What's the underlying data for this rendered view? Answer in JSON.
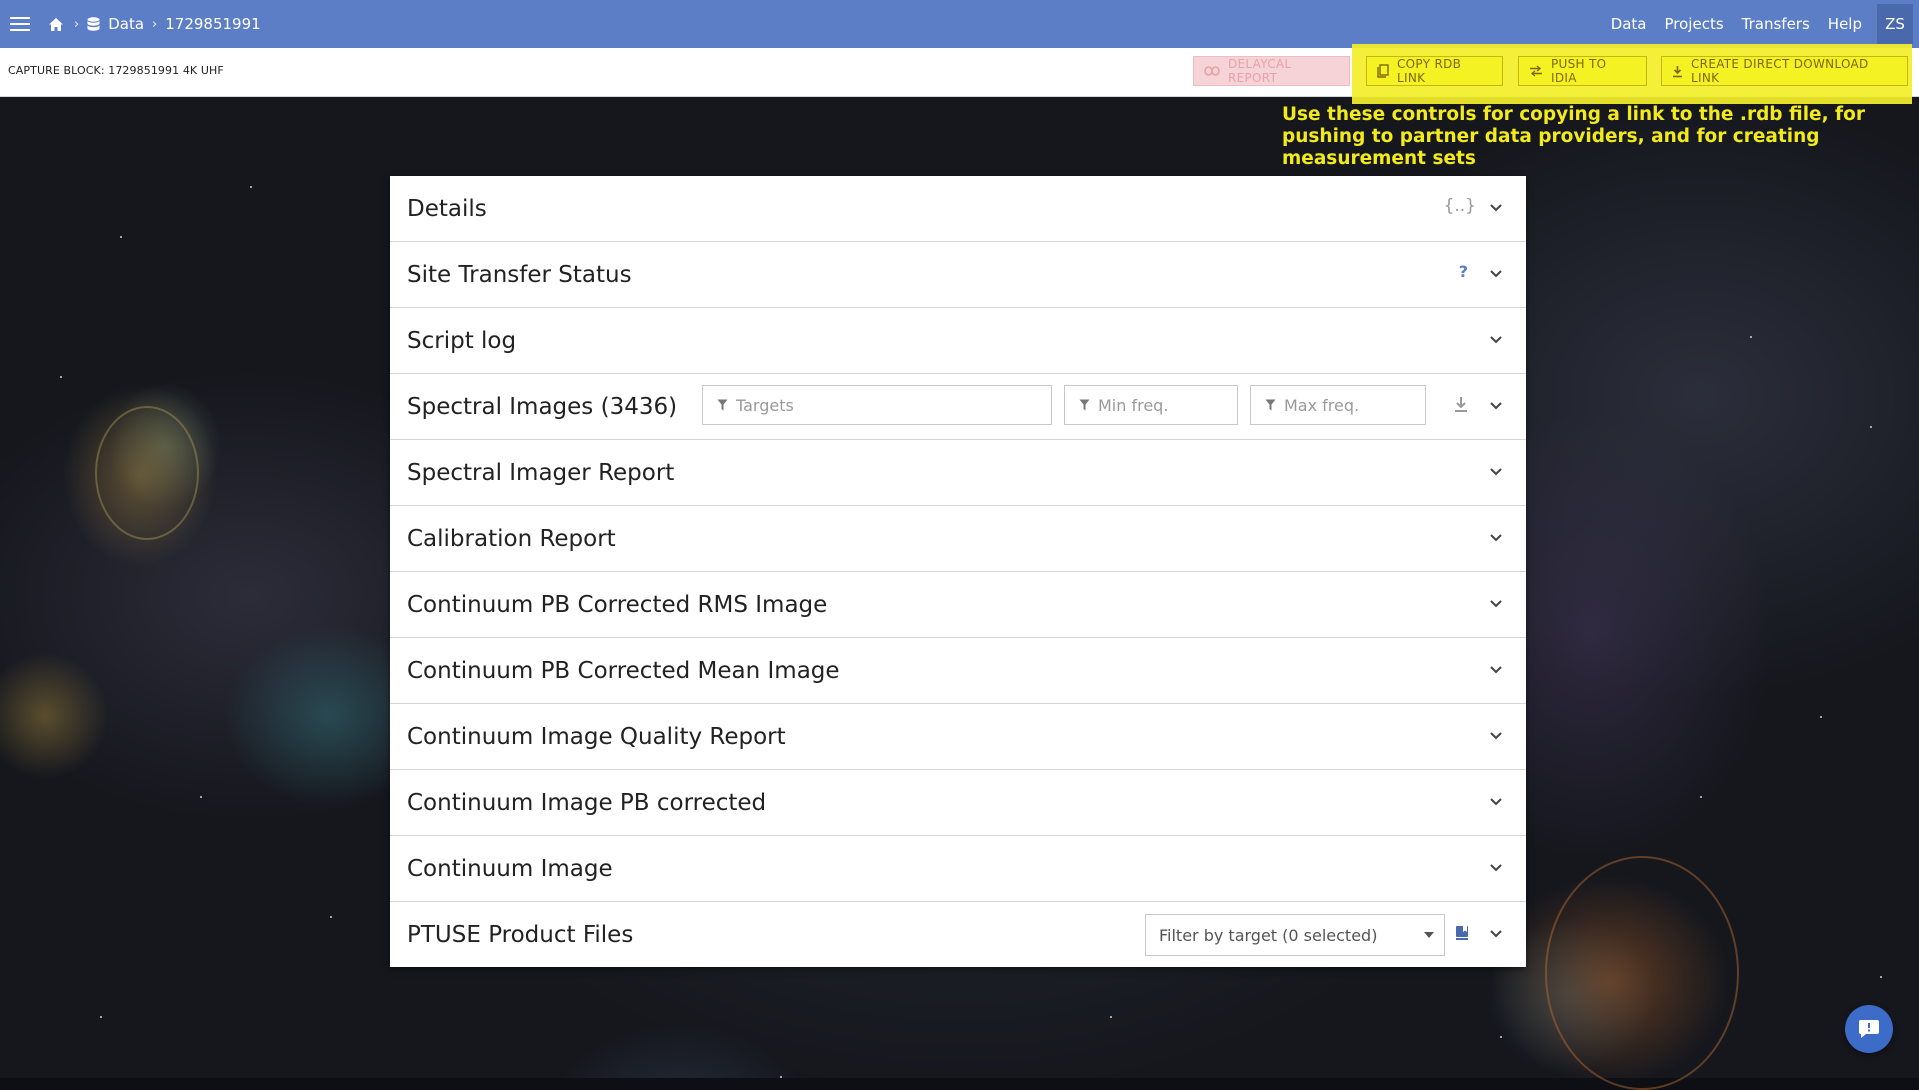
{
  "nav": {
    "breadcrumb_data": "Data",
    "breadcrumb_id": "1729851991",
    "links": [
      "Data",
      "Projects",
      "Transfers",
      "Help"
    ],
    "avatar_initials": "ZS"
  },
  "toolbar": {
    "capture_block_title": "CAPTURE BLOCK: 1729851991 4K UHF",
    "delaycal_label": "DELAYCAL REPORT",
    "copy_rdb_label": "COPY RDB LINK",
    "push_idia_label": "PUSH TO IDIA",
    "create_download_label": "CREATE DIRECT DOWNLOAD LINK"
  },
  "annotation": {
    "text": "Use these controls for copying a link to the .rdb file, for pushing to partner data providers, and for creating measurement sets"
  },
  "panels": [
    {
      "title": "Details"
    },
    {
      "title": "Site Transfer Status"
    },
    {
      "title": "Script log"
    },
    {
      "title": "Spectral Images (3436)"
    },
    {
      "title": "Spectral Imager Report"
    },
    {
      "title": "Calibration Report"
    },
    {
      "title": "Continuum PB Corrected RMS Image"
    },
    {
      "title": "Continuum PB Corrected Mean Image"
    },
    {
      "title": "Continuum Image Quality Report"
    },
    {
      "title": "Continuum Image PB corrected"
    },
    {
      "title": "Continuum Image"
    },
    {
      "title": "PTUSE Product Files"
    }
  ],
  "details_extra": {
    "json_icon_text": "{..}"
  },
  "site_transfer_extra": {
    "help_text": "?"
  },
  "spectral_filters": {
    "targets_placeholder": "Targets",
    "min_freq_placeholder": "Min freq.",
    "max_freq_placeholder": "Max freq."
  },
  "ptuse_filter": {
    "selected_text": "Filter by target (0 selected)"
  },
  "colors": {
    "navbar": "#5b7ec6",
    "highlight": "#f3ef2b",
    "annotation_text": "#f2ea1a",
    "delaycal_bg": "#f6d3d6",
    "fab": "#3d6cc8"
  },
  "icons": [
    "menu-icon",
    "home-icon",
    "database-icon",
    "link-icon",
    "copy-icon",
    "swap-icon",
    "download-icon",
    "filter-icon",
    "chevron-down-icon",
    "json-icon",
    "help-icon",
    "bookmark-icon",
    "chat-icon",
    "caret-down-icon"
  ]
}
